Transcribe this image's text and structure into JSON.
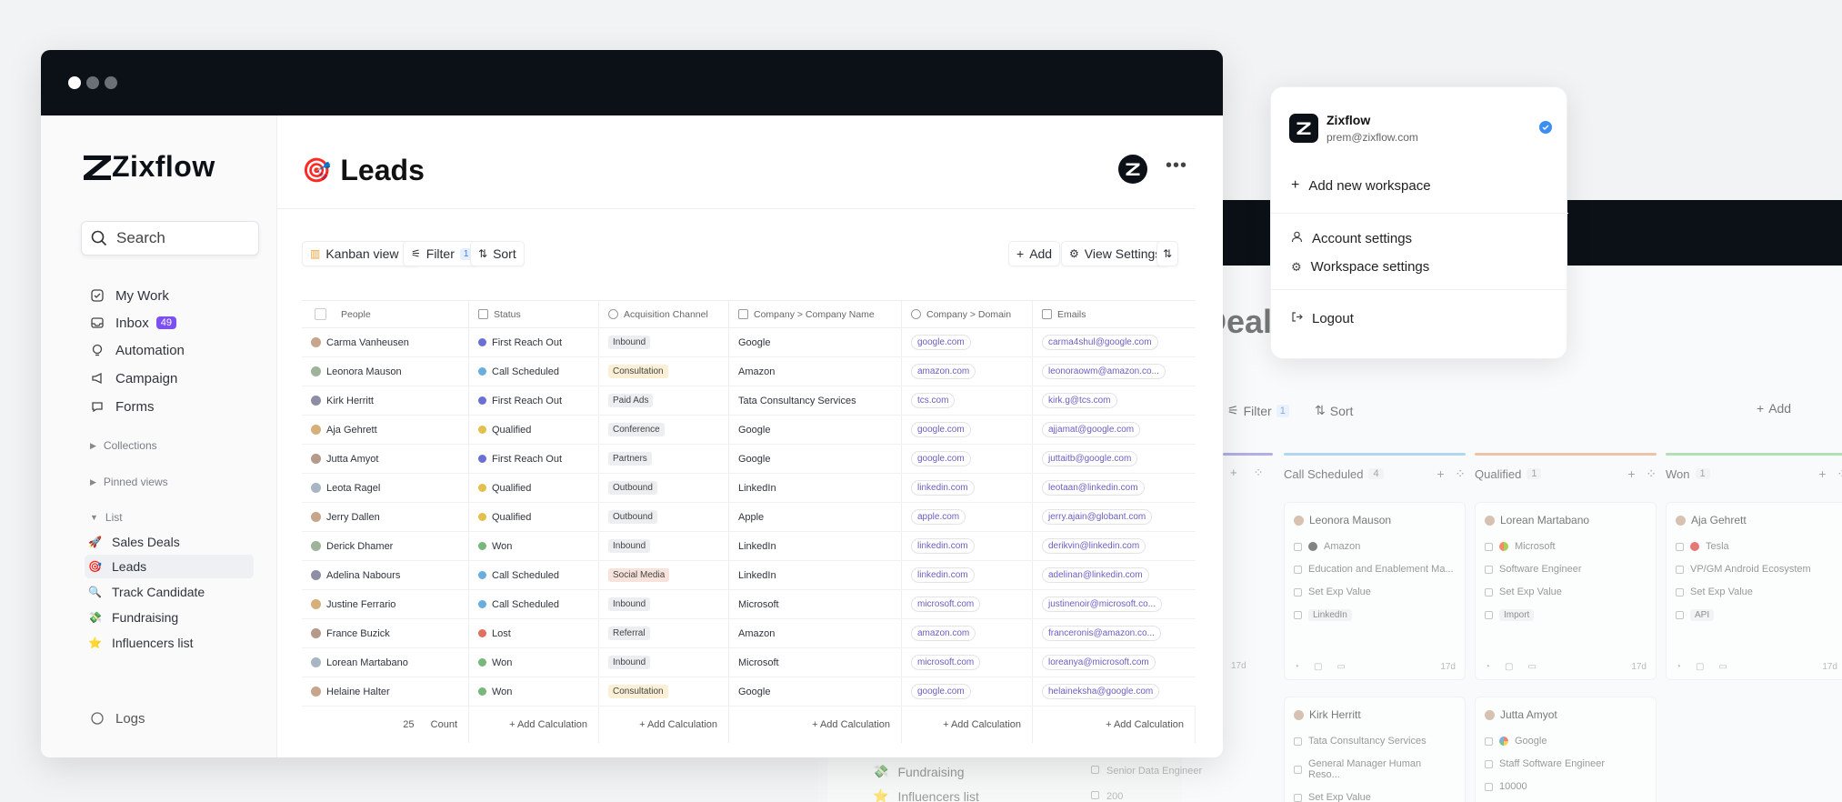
{
  "window": {
    "traffic_lights": [
      "#ffffff",
      "#6b7078",
      "#6b7078"
    ]
  },
  "brand": {
    "name": "Zixflow"
  },
  "search": {
    "placeholder": "Search"
  },
  "sidebar": {
    "nav": [
      {
        "label": "My Work",
        "icon": "checkbox-icon"
      },
      {
        "label": "Inbox",
        "icon": "inbox-icon",
        "badge": "49"
      },
      {
        "label": "Automation",
        "icon": "bulb-icon"
      },
      {
        "label": "Campaign",
        "icon": "megaphone-icon"
      },
      {
        "label": "Forms",
        "icon": "chat-icon"
      }
    ],
    "sections": {
      "collections": "Collections",
      "pinned": "Pinned views",
      "list": "List"
    },
    "lists": [
      {
        "label": "Sales Deals",
        "icon": "rocket-icon"
      },
      {
        "label": "Leads",
        "icon": "target-icon"
      },
      {
        "label": "Track Candidate",
        "icon": "magnifier-icon"
      },
      {
        "label": "Fundraising",
        "icon": "money-icon"
      },
      {
        "label": "Influencers list",
        "icon": "star-icon"
      }
    ],
    "logs": "Logs"
  },
  "page": {
    "title": "Leads"
  },
  "toolbar": {
    "view": "Kanban view",
    "filter": "Filter",
    "filter_count": "1",
    "sort": "Sort",
    "add": "Add",
    "view_settings": "View Settings"
  },
  "table": {
    "headers": [
      "People",
      "Status",
      "Acquisition Channel",
      "Company > Company Name",
      "Company > Domain",
      "Emails"
    ],
    "rows": [
      {
        "name": "Carma Vanheusen",
        "status": "First Reach Out",
        "channel": "Inbound",
        "company": "Google",
        "domain": "google.com",
        "email": "carma4shul@google.com"
      },
      {
        "name": "Leonora Mauson",
        "status": "Call Scheduled",
        "channel": "Consultation",
        "company": "Amazon",
        "domain": "amazon.com",
        "email": "leonoraowm@amazon.co..."
      },
      {
        "name": "Kirk Herritt",
        "status": "First Reach Out",
        "channel": "Paid Ads",
        "company": "Tata Consultancy Services",
        "domain": "tcs.com",
        "email": "kirk.g@tcs.com"
      },
      {
        "name": "Aja Gehrett",
        "status": "Qualified",
        "channel": "Conference",
        "company": "Google",
        "domain": "google.com",
        "email": "ajjamat@google.com"
      },
      {
        "name": "Jutta Amyot",
        "status": "First Reach Out",
        "channel": "Partners",
        "company": "Google",
        "domain": "google.com",
        "email": "juttaitb@google.com"
      },
      {
        "name": "Leota Ragel",
        "status": "Qualified",
        "channel": "Outbound",
        "company": "LinkedIn",
        "domain": "linkedin.com",
        "email": "leotaan@linkedin.com"
      },
      {
        "name": "Jerry Dallen",
        "status": "Qualified",
        "channel": "Outbound",
        "company": "Apple",
        "domain": "apple.com",
        "email": "jerry.ajain@globant.com"
      },
      {
        "name": "Derick Dhamer",
        "status": "Won",
        "channel": "Inbound",
        "company": "LinkedIn",
        "domain": "linkedin.com",
        "email": "derikvin@linkedin.com"
      },
      {
        "name": "Adelina Nabours",
        "status": "Call Scheduled",
        "channel": "Social Media",
        "company": "LinkedIn",
        "domain": "linkedin.com",
        "email": "adelinan@linkedin.com"
      },
      {
        "name": "Justine Ferrario",
        "status": "Call Scheduled",
        "channel": "Inbound",
        "company": "Microsoft",
        "domain": "microsoft.com",
        "email": "justinenoir@microsoft.co..."
      },
      {
        "name": "France Buzick",
        "status": "Lost",
        "channel": "Referral",
        "company": "Amazon",
        "domain": "amazon.com",
        "email": "franceronis@amazon.co..."
      },
      {
        "name": "Lorean Martabano",
        "status": "Won",
        "channel": "Inbound",
        "company": "Microsoft",
        "domain": "microsoft.com",
        "email": "loreanya@microsoft.com"
      },
      {
        "name": "Helaine Halter",
        "status": "Won",
        "channel": "Consultation",
        "company": "Google",
        "domain": "google.com",
        "email": "helaineksha@google.com"
      }
    ],
    "footer": {
      "count_num": "25",
      "count_label": "Count",
      "add_calc": "+ Add Calculation"
    }
  },
  "status_colors": {
    "First Reach Out": "#6b6fd6",
    "Call Scheduled": "#6aaee0",
    "Qualified": "#e3bf4e",
    "Won": "#76b77a",
    "Lost": "#e07060"
  },
  "channel_colors": {
    "Consultation": "#fbf0d6",
    "Social Media": "#f8e3dc",
    "default": "#eceef1"
  },
  "dropdown": {
    "workspace_name": "Zixflow",
    "workspace_email": "prem@zixflow.com",
    "add_workspace": "Add new workspace",
    "account_settings": "Account settings",
    "workspace_settings": "Workspace settings",
    "logout": "Logout"
  },
  "background_board": {
    "title": "Deals",
    "filter": "Filter",
    "filter_count": "1",
    "sort": "Sort",
    "add": "Add",
    "columns": [
      {
        "name": "Call Scheduled",
        "count": "4",
        "color": "#8ec4ec"
      },
      {
        "name": "Qualified",
        "count": "1",
        "color": "#e9a77a"
      },
      {
        "name": "Won",
        "count": "1",
        "color": "#8fcf93"
      }
    ],
    "first_column_color": "#8d87d8",
    "cards": [
      {
        "name": "Leonora Mauson",
        "company": "Amazon",
        "title": "Education and Enablement Ma...",
        "value": "Set Exp Value",
        "tag": "LinkedIn",
        "age": "17d",
        "logo_color": "#444"
      },
      {
        "name": "Lorean Martabano",
        "company": "Microsoft",
        "title": "Software Engineer",
        "value": "Set Exp Value",
        "tag": "Import",
        "age": "17d",
        "logo_color": "#f25022"
      },
      {
        "name": "Aja Gehrett",
        "company": "Tesla",
        "title": "VP/GM Android Ecosystem",
        "value": "Set Exp Value",
        "tag": "API",
        "age": "17d",
        "logo_color": "#d33"
      },
      {
        "name": "Kirk Herritt",
        "company": "Tata Consultancy Services",
        "title": "General Manager Human Reso...",
        "value": "Set Exp Value"
      },
      {
        "name": "Jutta Amyot",
        "company": "Google",
        "title": "Staff Software Engineer",
        "value": "10000"
      }
    ],
    "stray_age": "17d",
    "stray_title": "Senior Data Engineer",
    "stray_value": "200",
    "sidebar_items": [
      "Fundraising",
      "Influencers list"
    ]
  }
}
